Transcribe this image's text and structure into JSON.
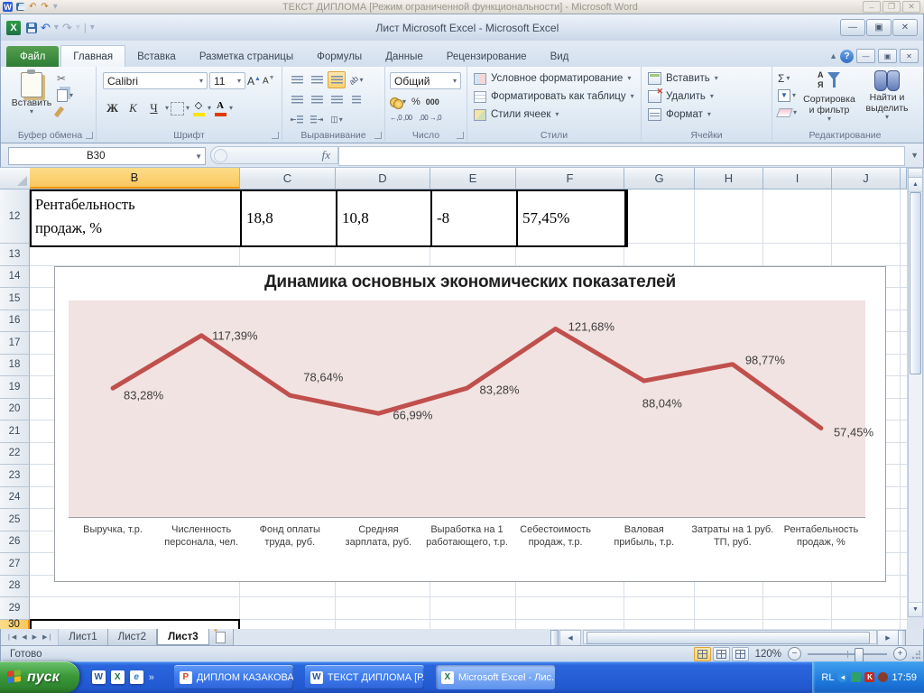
{
  "word_window": {
    "title": "ТЕКСТ ДИПЛОМА [Режим ограниченной функциональности]  -  Microsoft Word"
  },
  "excel_window": {
    "title": "Лист Microsoft Excel  -  Microsoft Excel"
  },
  "ribbon": {
    "tabs": [
      "Файл",
      "Главная",
      "Вставка",
      "Разметка страницы",
      "Формулы",
      "Данные",
      "Рецензирование",
      "Вид"
    ],
    "active_tab": "Главная",
    "clipboard": {
      "label": "Буфер обмена",
      "paste": "Вставить"
    },
    "font": {
      "label": "Шрифт",
      "name": "Calibri",
      "size": "11",
      "bold": "Ж",
      "italic": "К",
      "underline": "Ч"
    },
    "alignment": {
      "label": "Выравнивание"
    },
    "number": {
      "label": "Число",
      "format": "Общий",
      "percent": "%",
      "thousands": "000"
    },
    "styles": {
      "label": "Стили",
      "items": [
        "Условное форматирование",
        "Форматировать как таблицу",
        "Стили ячеек"
      ]
    },
    "cells": {
      "label": "Ячейки",
      "items": [
        "Вставить",
        "Удалить",
        "Формат"
      ]
    },
    "editing": {
      "label": "Редактирование",
      "sigma": "Σ",
      "sort": "Сортировка и фильтр",
      "find": "Найти и выделить"
    }
  },
  "formula_bar": {
    "name_box": "B30",
    "fx": "fx",
    "formula": ""
  },
  "grid": {
    "columns": [
      "B",
      "C",
      "D",
      "E",
      "F",
      "G",
      "H",
      "I",
      "J"
    ],
    "selected_column": "B",
    "first_row": 12,
    "last_row": 30,
    "selected_row": 30,
    "selected_cell": "B30",
    "row12": {
      "label": "Рентабельность продаж, %",
      "values": [
        "18,8",
        "10,8",
        "-8",
        "57,45%"
      ]
    }
  },
  "chart_data": {
    "type": "line",
    "title": "Динамика основных экономических показателей",
    "categories": [
      "Выручка, т.р.",
      "Численность персонала, чел.",
      "Фонд оплаты труда, руб.",
      "Средняя зарплата, руб.",
      "Выработка на 1 работающего, т.р.",
      "Себестоимость продаж, т.р.",
      "Валовая прибыль, т.р.",
      "Затраты на 1 руб. ТП, руб.",
      "Рентабельность продаж, %"
    ],
    "values": [
      83.28,
      117.39,
      78.64,
      66.99,
      83.28,
      121.68,
      88.04,
      98.77,
      57.45
    ],
    "labels": [
      "83,28%",
      "117,39%",
      "78,64%",
      "66,99%",
      "83,28%",
      "121,68%",
      "88,04%",
      "98,77%",
      "57,45%"
    ],
    "ylim": [
      0,
      140
    ],
    "gridlines": false,
    "legend": "none",
    "line_color": "#C0504D",
    "plot_bg": "#F1E3E2"
  },
  "sheet_tabs": {
    "tabs": [
      "Лист1",
      "Лист2",
      "Лист3"
    ],
    "active": "Лист3"
  },
  "status_bar": {
    "mode": "Готово",
    "zoom": "120%"
  },
  "taskbar": {
    "start": "пуск",
    "buttons": [
      {
        "app": "powerpoint",
        "label": "ДИПЛОМ КАЗАКОВА..."
      },
      {
        "app": "word",
        "label": "ТЕКСТ ДИПЛОМА [Р..."
      },
      {
        "app": "excel",
        "label": "Microsoft Excel - Лис...",
        "active": true
      }
    ],
    "tray": {
      "lang": "RL",
      "time": "17:59"
    }
  }
}
